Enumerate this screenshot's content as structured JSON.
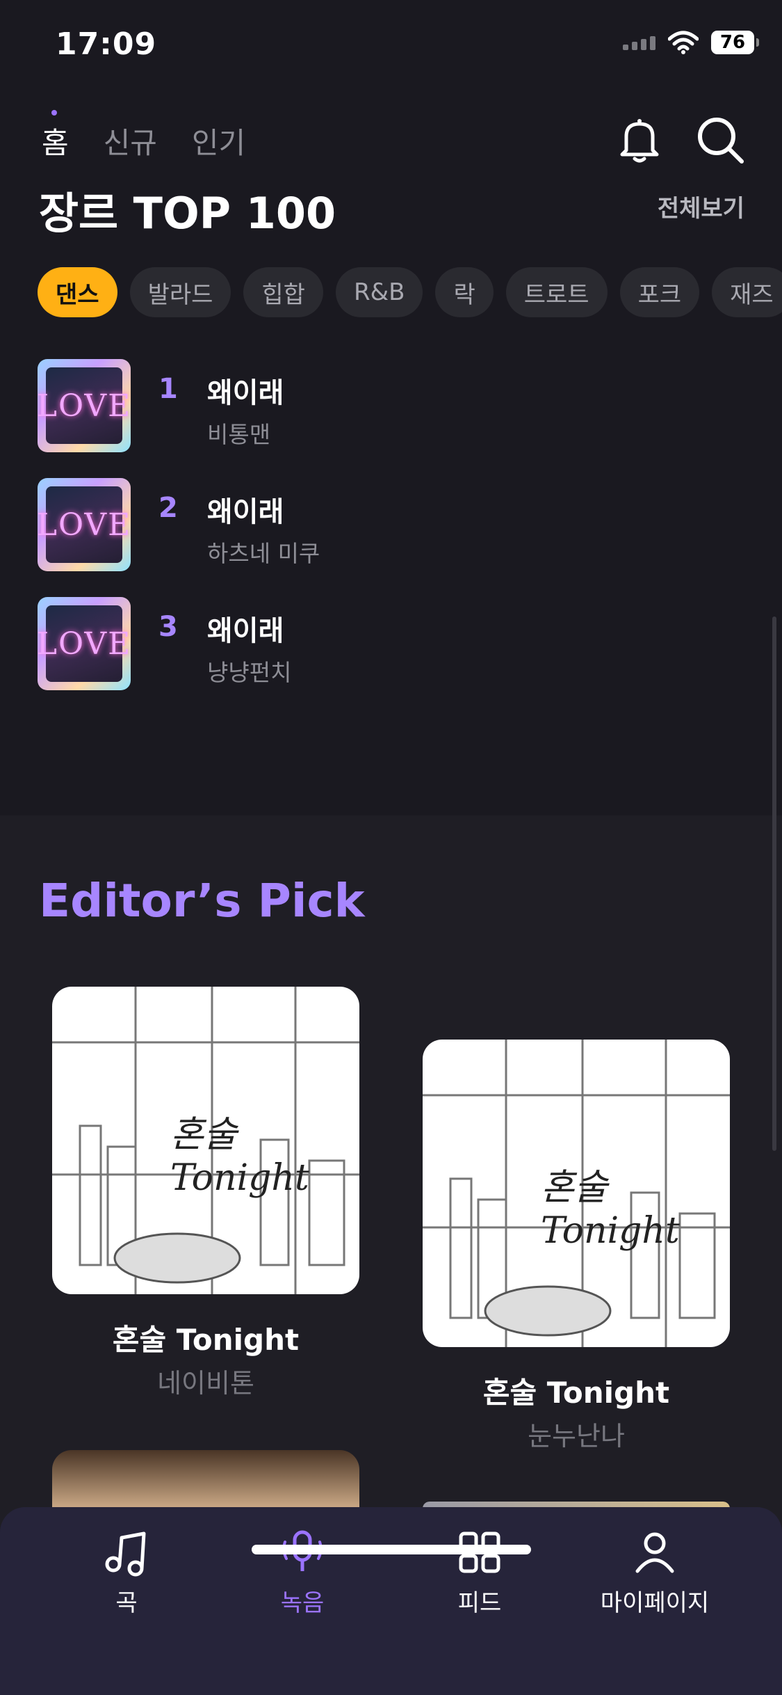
{
  "status_bar": {
    "time": "17:09",
    "battery": "76"
  },
  "top_nav": {
    "tabs": [
      "홈",
      "신규",
      "인기"
    ],
    "active": "홈"
  },
  "genre_section": {
    "title": "장르 TOP 100",
    "see_all": "전체보기",
    "chips": [
      "댄스",
      "발라드",
      "힙합",
      "R&B",
      "락",
      "트로트",
      "포크",
      "재즈"
    ],
    "active_chip": "댄스",
    "chart": [
      {
        "rank": "1",
        "title": "왜이래",
        "artist": "비통맨"
      },
      {
        "rank": "2",
        "title": "왜이래",
        "artist": "하츠네 미쿠"
      },
      {
        "rank": "3",
        "title": "왜이래",
        "artist": "냥냥펀치"
      }
    ],
    "cover_text": "LOVE"
  },
  "editor_pick": {
    "title": "Editor’s Pick",
    "items": [
      {
        "title": "혼술 Tonight",
        "artist": "네이비톤"
      },
      {
        "title": "혼술 Tonight",
        "artist": "눈누난나"
      }
    ],
    "album_text": "혼술 Tonight"
  },
  "bottom_nav": {
    "items": [
      {
        "label": "곡",
        "icon": "music-note-icon"
      },
      {
        "label": "녹음",
        "icon": "microphone-icon"
      },
      {
        "label": "피드",
        "icon": "grid-icon"
      },
      {
        "label": "마이페이지",
        "icon": "person-icon"
      }
    ],
    "active": "녹음"
  },
  "colors": {
    "accent": "#9b73ff",
    "chip_active": "#ffb014",
    "background": "#1a1920"
  }
}
